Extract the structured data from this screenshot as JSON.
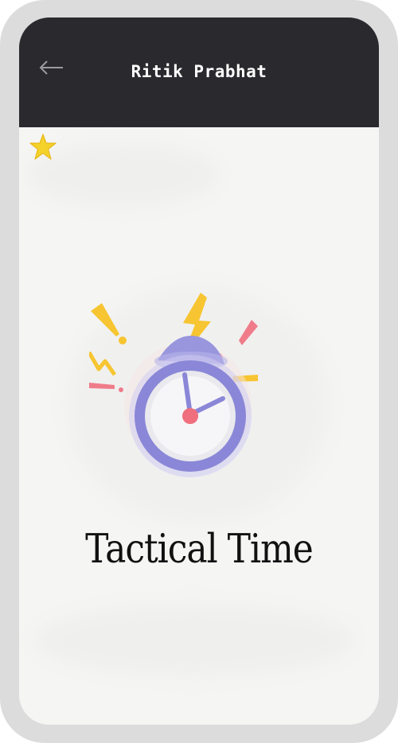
{
  "header": {
    "title": "Ritik Prabhat",
    "back_icon": "arrow-left-icon"
  },
  "main": {
    "title": "Tactical Time",
    "illustration": "alarm-clock-icon",
    "decoration": "star-icon"
  },
  "colors": {
    "header_bg": "#2a2a2e",
    "content_bg": "#f5f5f4",
    "clock_ring": "#8a87d8",
    "accent_yellow": "#f7c531",
    "accent_pink": "#f07c8a"
  }
}
